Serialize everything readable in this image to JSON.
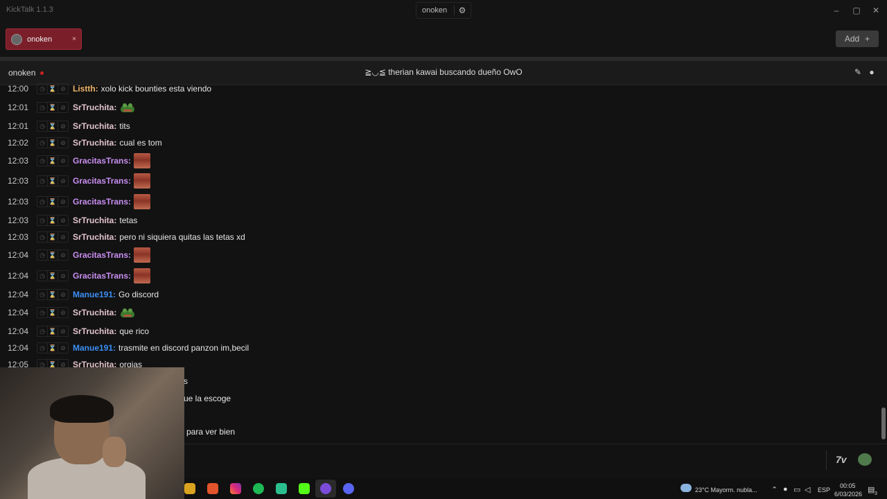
{
  "app": {
    "title": "KickTalk 1.1.3"
  },
  "titlebar": {
    "channel": "onoken",
    "settings_icon": "gear-icon",
    "minimize": "–",
    "maximize": "▢",
    "close": "✕"
  },
  "tabs": [
    {
      "label": "onoken",
      "close": "×",
      "active": true
    }
  ],
  "add_button": {
    "label": "Add",
    "icon": "+"
  },
  "channel": {
    "name": "onoken",
    "stream_title": "≧◡≦ therian kawai buscando dueño OwO",
    "live": true
  },
  "colors": {
    "accent_tab": "#7a1f2a",
    "listth": "#f0b46a",
    "srtruchita": "#e3c3cc",
    "gracitas": "#c98ff2",
    "manue": "#3b8ef3"
  },
  "messages": [
    {
      "time": "12:00",
      "user": "Listth:",
      "color": "listth",
      "text": "xolo kick bounties esta viendo",
      "emote": null
    },
    {
      "time": "12:01",
      "user": "SrTruchita:",
      "color": "sr",
      "text": "",
      "emote": "frog"
    },
    {
      "time": "12:01",
      "user": "SrTruchita:",
      "color": "sr",
      "text": "tits",
      "emote": null
    },
    {
      "time": "12:02",
      "user": "SrTruchita:",
      "color": "sr",
      "text": "cual es tom",
      "emote": null
    },
    {
      "time": "12:03",
      "user": "GracitasTrans:",
      "color": "grac",
      "text": "",
      "emote": "face"
    },
    {
      "time": "12:03",
      "user": "GracitasTrans:",
      "color": "grac",
      "text": "",
      "emote": "face"
    },
    {
      "time": "12:03",
      "user": "GracitasTrans:",
      "color": "grac",
      "text": "",
      "emote": "face"
    },
    {
      "time": "12:03",
      "user": "SrTruchita:",
      "color": "sr",
      "text": "tetas",
      "emote": null
    },
    {
      "time": "12:03",
      "user": "SrTruchita:",
      "color": "sr",
      "text": "pero ni siquiera quitas las tetas xd",
      "emote": null
    },
    {
      "time": "12:04",
      "user": "GracitasTrans:",
      "color": "grac",
      "text": "",
      "emote": "face"
    },
    {
      "time": "12:04",
      "user": "GracitasTrans:",
      "color": "grac",
      "text": "",
      "emote": "face"
    },
    {
      "time": "12:04",
      "user": "Manue191:",
      "color": "manu",
      "text": "Go discord",
      "emote": null
    },
    {
      "time": "12:04",
      "user": "SrTruchita:",
      "color": "sr",
      "text": "",
      "emote": "frog"
    },
    {
      "time": "12:04",
      "user": "SrTruchita:",
      "color": "sr",
      "text": "que rico",
      "emote": null
    },
    {
      "time": "12:04",
      "user": "Manue191:",
      "color": "manu",
      "text": "trasmite en discord panzon im,becil",
      "emote": null
    },
    {
      "time": "12:05",
      "user": "SrTruchita:",
      "color": "sr",
      "text": "orgias",
      "emote": null
    }
  ],
  "partial_messages": [
    "s",
    "ue la escoge",
    "para ver bien"
  ],
  "input": {
    "placeholder": "",
    "seventv": "7v"
  },
  "taskbar": {
    "weather": "23°C  Mayorm. nubla...",
    "language": "ESP",
    "time": "00:05",
    "date": "6/03/2026",
    "notification_badge": "3"
  }
}
